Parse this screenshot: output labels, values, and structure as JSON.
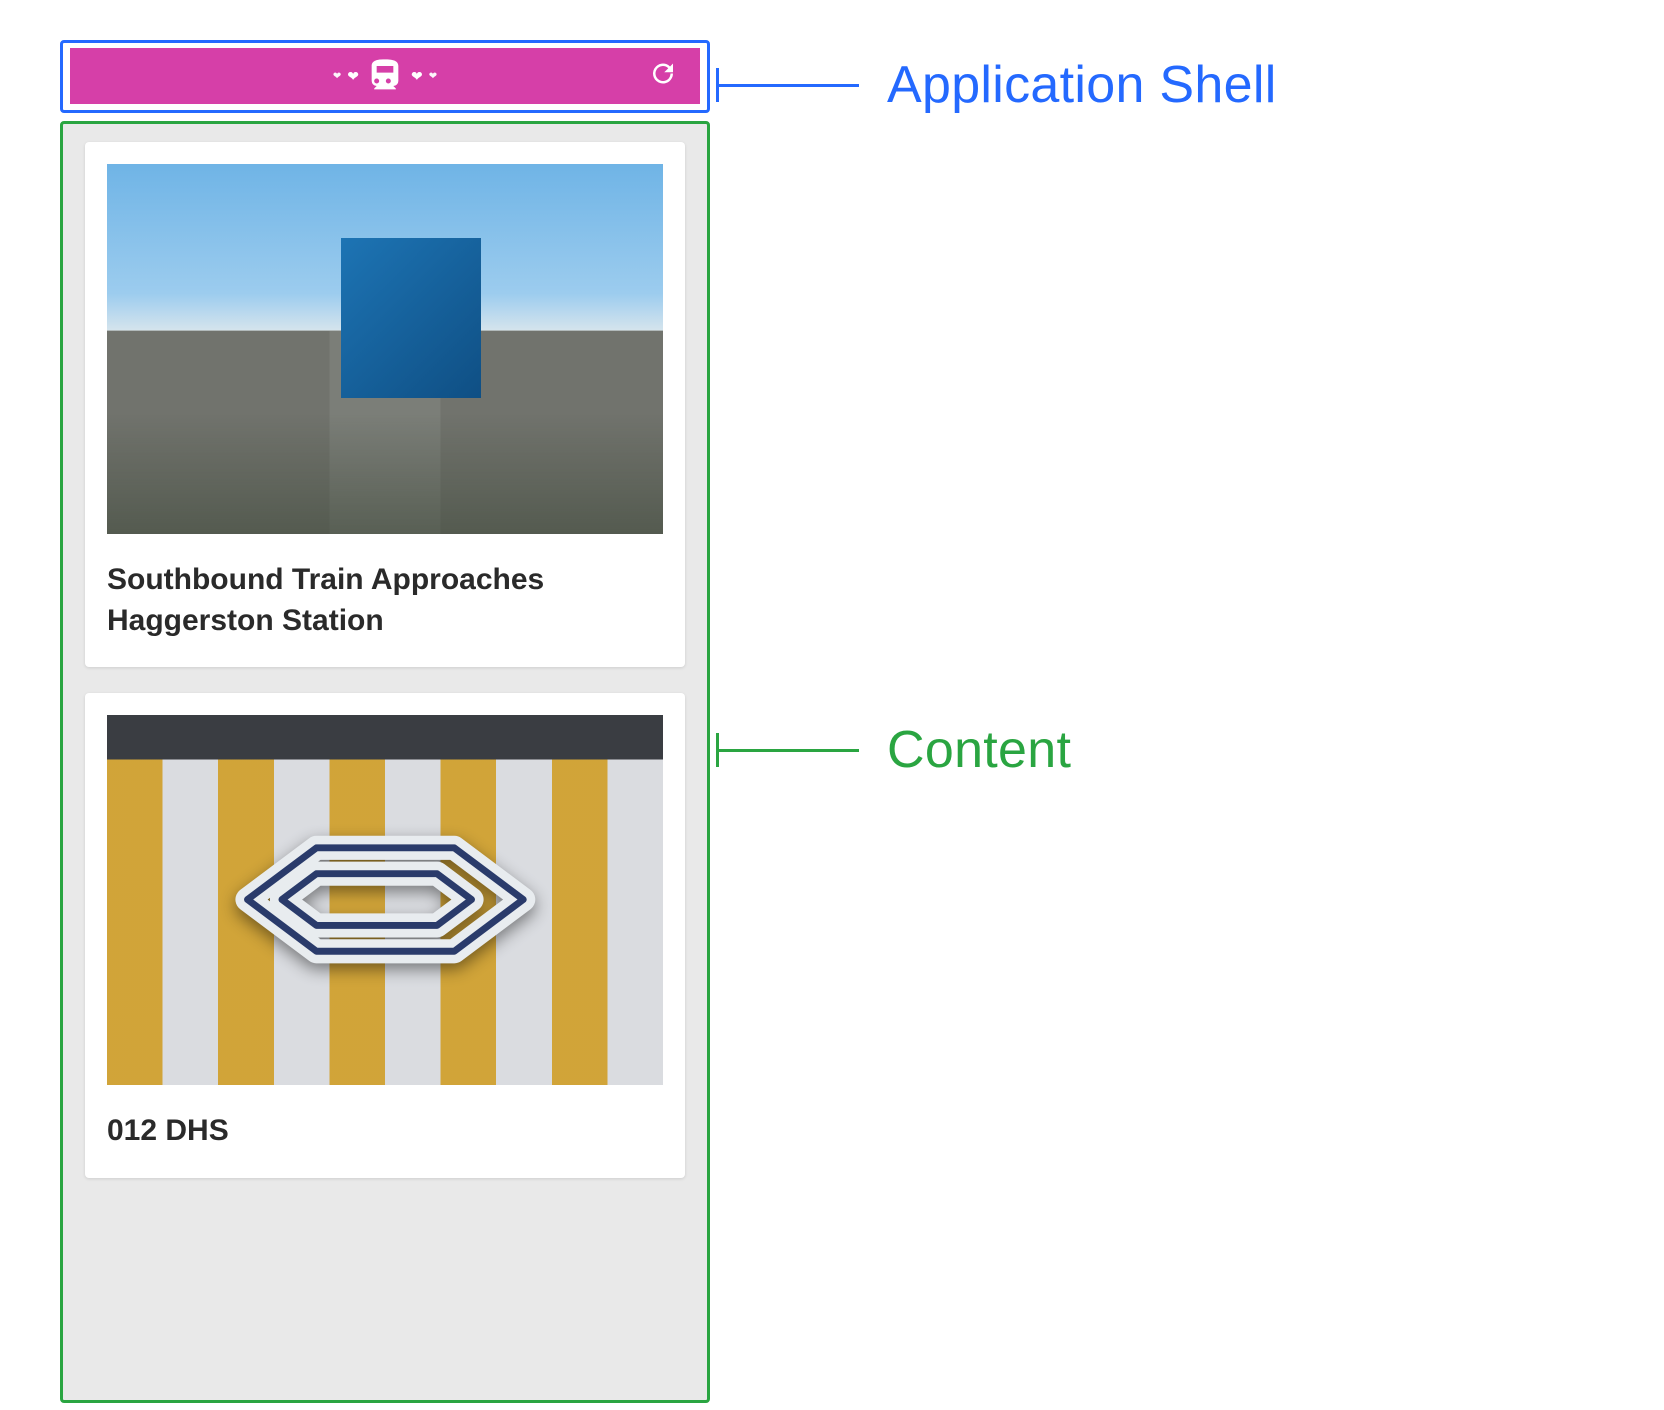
{
  "annotations": {
    "shell_label": "Application Shell",
    "content_label": "Content",
    "shell_color": "#2469ff",
    "content_color": "#2aa541"
  },
  "shell": {
    "brand_color": "#d63fa8",
    "logo_name": "train-hearts-logo",
    "buttons": {
      "refresh_name": "refresh"
    }
  },
  "content": {
    "cards": [
      {
        "title": "Southbound Train Approaches Haggerston Station"
      },
      {
        "title": "012 DHS"
      }
    ]
  }
}
